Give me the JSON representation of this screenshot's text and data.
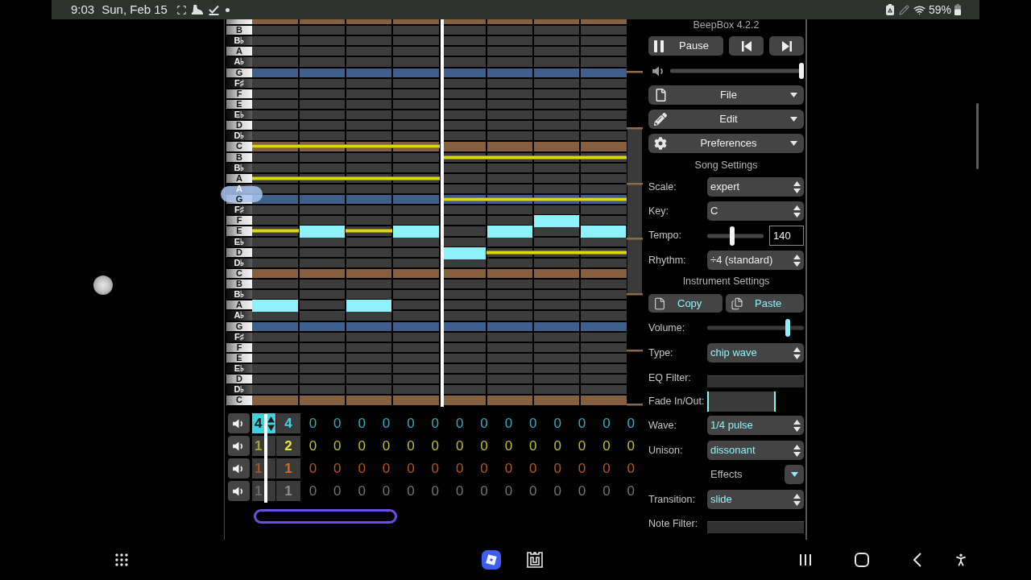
{
  "status_bar": {
    "time": "9:03",
    "date": "Sun, Feb 15",
    "battery": "59%"
  },
  "piano_roll": {
    "rows": [
      {
        "kind": "white",
        "color": "#86603e"
      },
      {
        "label": "B",
        "kind": "white",
        "color": "#3c3c3c"
      },
      {
        "label": "B♭",
        "kind": "black",
        "color": "#3c3c3c"
      },
      {
        "label": "A",
        "kind": "white",
        "color": "#3c3c3c"
      },
      {
        "label": "A♭",
        "kind": "black",
        "color": "#3c3c3c"
      },
      {
        "label": "G",
        "kind": "white",
        "color": "#3d5f8a"
      },
      {
        "label": "F♯",
        "kind": "black",
        "color": "#3c3c3c"
      },
      {
        "label": "F",
        "kind": "white",
        "color": "#3c3c3c"
      },
      {
        "label": "E",
        "kind": "white",
        "color": "#3c3c3c"
      },
      {
        "label": "E♭",
        "kind": "black",
        "color": "#3c3c3c"
      },
      {
        "label": "D",
        "kind": "white",
        "color": "#3c3c3c"
      },
      {
        "label": "D♭",
        "kind": "black",
        "color": "#3c3c3c"
      },
      {
        "label": "C",
        "kind": "white",
        "color": "#86603e",
        "beats": [
          {
            "kind": "ghost"
          },
          {
            "kind": "ghost"
          },
          {
            "kind": "ghost"
          },
          {
            "kind": "ghost"
          },
          {
            "kind": "none"
          },
          {
            "kind": "none"
          },
          {
            "kind": "none"
          },
          {
            "kind": "none"
          }
        ]
      },
      {
        "label": "B",
        "kind": "white",
        "color": "#3c3c3c",
        "beats": [
          {
            "kind": "none"
          },
          {
            "kind": "none"
          },
          {
            "kind": "none"
          },
          {
            "kind": "none"
          },
          {
            "kind": "ghost"
          },
          {
            "kind": "ghost"
          },
          {
            "kind": "ghost"
          },
          {
            "kind": "ghost"
          }
        ]
      },
      {
        "label": "B♭",
        "kind": "black",
        "color": "#3c3c3c"
      },
      {
        "label": "A",
        "kind": "white",
        "color": "#3c3c3c",
        "beats": [
          {
            "kind": "ghost"
          },
          {
            "kind": "ghost"
          },
          {
            "kind": "ghost"
          },
          {
            "kind": "ghost"
          },
          {
            "kind": "none"
          },
          {
            "kind": "none"
          },
          {
            "kind": "none"
          },
          {
            "kind": "none"
          }
        ]
      },
      {
        "label": "A",
        "kind": "black",
        "color": "#3c3c3c"
      },
      {
        "label": "G",
        "kind": "white",
        "color": "#3d5f8a",
        "beats": [
          {
            "kind": "none"
          },
          {
            "kind": "none"
          },
          {
            "kind": "none"
          },
          {
            "kind": "none"
          },
          {
            "kind": "ghost"
          },
          {
            "kind": "ghost"
          },
          {
            "kind": "ghost"
          },
          {
            "kind": "ghost"
          }
        ]
      },
      {
        "label": "F♯",
        "kind": "black",
        "color": "#3c3c3c"
      },
      {
        "label": "F",
        "kind": "white",
        "color": "#3c3c3c",
        "beats": [
          {
            "kind": "none"
          },
          {
            "kind": "none"
          },
          {
            "kind": "none"
          },
          {
            "kind": "none"
          },
          {
            "kind": "none"
          },
          {
            "kind": "none"
          },
          {
            "kind": "note"
          },
          {
            "kind": "none"
          }
        ]
      },
      {
        "label": "E",
        "kind": "white",
        "color": "#3c3c3c",
        "beats": [
          {
            "kind": "ghost"
          },
          {
            "kind": "note"
          },
          {
            "kind": "ghost"
          },
          {
            "kind": "note"
          },
          {
            "kind": "none"
          },
          {
            "kind": "note"
          },
          {
            "kind": "none"
          },
          {
            "kind": "note"
          }
        ]
      },
      {
        "label": "E♭",
        "kind": "black",
        "color": "#3c3c3c"
      },
      {
        "label": "D",
        "kind": "white",
        "color": "#3c3c3c",
        "beats": [
          {
            "kind": "none"
          },
          {
            "kind": "none"
          },
          {
            "kind": "none"
          },
          {
            "kind": "none"
          },
          {
            "kind": "note"
          },
          {
            "kind": "ghost"
          },
          {
            "kind": "ghost"
          },
          {
            "kind": "ghost"
          }
        ]
      },
      {
        "label": "D♭",
        "kind": "black",
        "color": "#3c3c3c"
      },
      {
        "label": "C",
        "kind": "white",
        "color": "#86603e"
      },
      {
        "label": "B",
        "kind": "white",
        "color": "#3c3c3c"
      },
      {
        "label": "B♭",
        "kind": "black",
        "color": "#3c3c3c"
      },
      {
        "label": "A",
        "kind": "white",
        "color": "#3c3c3c",
        "beats": [
          {
            "kind": "note"
          },
          {
            "kind": "none"
          },
          {
            "kind": "note"
          },
          {
            "kind": "none"
          },
          {
            "kind": "none"
          },
          {
            "kind": "none"
          },
          {
            "kind": "none"
          },
          {
            "kind": "none"
          }
        ]
      },
      {
        "label": "A♭",
        "kind": "black",
        "color": "#3c3c3c"
      },
      {
        "label": "G",
        "kind": "white",
        "color": "#3d5f8a"
      },
      {
        "label": "F♯",
        "kind": "black",
        "color": "#3c3c3c"
      },
      {
        "label": "F",
        "kind": "white",
        "color": "#3c3c3c"
      },
      {
        "label": "E",
        "kind": "white",
        "color": "#3c3c3c"
      },
      {
        "label": "E♭",
        "kind": "black",
        "color": "#3c3c3c"
      },
      {
        "label": "D",
        "kind": "white",
        "color": "#3c3c3c"
      },
      {
        "label": "D♭",
        "kind": "black",
        "color": "#3c3c3c"
      },
      {
        "label": "C",
        "kind": "white",
        "color": "#86603e"
      }
    ]
  },
  "tracks": {
    "channels": [
      {
        "color": "#3fd2dc",
        "cells": [
          {
            "label": "4",
            "kind": "faded",
            "selected": true
          },
          {
            "label": "4",
            "kind": "pattern",
            "selected": false
          },
          {
            "label": "0",
            "kind": "empty",
            "selected": false
          },
          {
            "label": "0",
            "kind": "empty",
            "selected": false
          },
          {
            "label": "0",
            "kind": "empty",
            "selected": false
          },
          {
            "label": "0",
            "kind": "empty",
            "selected": false
          },
          {
            "label": "0",
            "kind": "empty",
            "selected": false
          },
          {
            "label": "0",
            "kind": "empty",
            "selected": false
          },
          {
            "label": "0",
            "kind": "empty",
            "selected": false
          },
          {
            "label": "0",
            "kind": "empty",
            "selected": false
          },
          {
            "label": "0",
            "kind": "empty",
            "selected": false
          },
          {
            "label": "0",
            "kind": "empty",
            "selected": false
          },
          {
            "label": "0",
            "kind": "empty",
            "selected": false
          },
          {
            "label": "0",
            "kind": "empty",
            "selected": false
          },
          {
            "label": "0",
            "kind": "empty",
            "selected": false
          },
          {
            "label": "0",
            "kind": "empty",
            "selected": false
          }
        ]
      },
      {
        "color": "#e8e83e",
        "cells": [
          {
            "label": "1",
            "kind": "faded",
            "selected": false
          },
          {
            "label": "2",
            "kind": "pattern",
            "selected": false
          },
          {
            "label": "0",
            "kind": "empty",
            "selected": false
          },
          {
            "label": "0",
            "kind": "empty",
            "selected": false
          },
          {
            "label": "0",
            "kind": "empty",
            "selected": false
          },
          {
            "label": "0",
            "kind": "empty",
            "selected": false
          },
          {
            "label": "0",
            "kind": "empty",
            "selected": false
          },
          {
            "label": "0",
            "kind": "empty",
            "selected": false
          },
          {
            "label": "0",
            "kind": "empty",
            "selected": false
          },
          {
            "label": "0",
            "kind": "empty",
            "selected": false
          },
          {
            "label": "0",
            "kind": "empty",
            "selected": false
          },
          {
            "label": "0",
            "kind": "empty",
            "selected": false
          },
          {
            "label": "0",
            "kind": "empty",
            "selected": false
          },
          {
            "label": "0",
            "kind": "empty",
            "selected": false
          },
          {
            "label": "0",
            "kind": "empty",
            "selected": false
          },
          {
            "label": "0",
            "kind": "empty",
            "selected": false
          }
        ]
      },
      {
        "color": "#d66a22",
        "cells": [
          {
            "label": "1",
            "kind": "faded",
            "selected": false
          },
          {
            "label": "1",
            "kind": "pattern",
            "selected": false
          },
          {
            "label": "0",
            "kind": "empty",
            "selected": false
          },
          {
            "label": "0",
            "kind": "empty",
            "selected": false
          },
          {
            "label": "0",
            "kind": "empty",
            "selected": false
          },
          {
            "label": "0",
            "kind": "empty",
            "selected": false
          },
          {
            "label": "0",
            "kind": "empty",
            "selected": false
          },
          {
            "label": "0",
            "kind": "empty",
            "selected": false
          },
          {
            "label": "0",
            "kind": "empty",
            "selected": false
          },
          {
            "label": "0",
            "kind": "empty",
            "selected": false
          },
          {
            "label": "0",
            "kind": "empty",
            "selected": false
          },
          {
            "label": "0",
            "kind": "empty",
            "selected": false
          },
          {
            "label": "0",
            "kind": "empty",
            "selected": false
          },
          {
            "label": "0",
            "kind": "empty",
            "selected": false
          },
          {
            "label": "0",
            "kind": "empty",
            "selected": false
          },
          {
            "label": "0",
            "kind": "empty",
            "selected": false
          }
        ]
      },
      {
        "color": "#8c8c8c",
        "cells": [
          {
            "label": "1",
            "kind": "faded",
            "selected": false
          },
          {
            "label": "1",
            "kind": "pattern",
            "selected": false
          },
          {
            "label": "0",
            "kind": "empty",
            "selected": false
          },
          {
            "label": "0",
            "kind": "empty",
            "selected": false
          },
          {
            "label": "0",
            "kind": "empty",
            "selected": false
          },
          {
            "label": "0",
            "kind": "empty",
            "selected": false
          },
          {
            "label": "0",
            "kind": "empty",
            "selected": false
          },
          {
            "label": "0",
            "kind": "empty",
            "selected": false
          },
          {
            "label": "0",
            "kind": "empty",
            "selected": false
          },
          {
            "label": "0",
            "kind": "empty",
            "selected": false
          },
          {
            "label": "0",
            "kind": "empty",
            "selected": false
          },
          {
            "label": "0",
            "kind": "empty",
            "selected": false
          },
          {
            "label": "0",
            "kind": "empty",
            "selected": false
          },
          {
            "label": "0",
            "kind": "empty",
            "selected": false
          },
          {
            "label": "0",
            "kind": "empty",
            "selected": false
          },
          {
            "label": "0",
            "kind": "empty",
            "selected": false
          }
        ]
      }
    ]
  },
  "panel": {
    "version": "BeepBox 4.2.2",
    "transport": [
      {
        "kind": "pause",
        "label": "Pause"
      },
      {
        "kind": "previous"
      },
      {
        "kind": "next"
      }
    ],
    "volume": {
      "level": 1
    },
    "menus": [
      {
        "kind": "file",
        "label": "File"
      },
      {
        "kind": "edit",
        "label": "Edit"
      },
      {
        "kind": "preferences",
        "label": "Preferences"
      }
    ],
    "song_settings": {
      "title": "Song Settings",
      "rows": [
        {
          "kind": "select",
          "label": "Scale:",
          "value": "expert"
        },
        {
          "kind": "select",
          "label": "Key:",
          "value": "C"
        },
        {
          "kind": "tempo",
          "label": "Tempo:",
          "level": 0.43,
          "value": "140"
        },
        {
          "kind": "select",
          "label": "Rhythm:",
          "value": "÷4 (standard)"
        }
      ]
    },
    "instrument_settings": {
      "title": "Instrument Settings",
      "clipboard": [
        {
          "kind": "copy",
          "label": "Copy"
        },
        {
          "kind": "paste",
          "label": "Paste"
        }
      ],
      "rows": [
        {
          "kind": "slider",
          "label": "Volume:",
          "level": 0.85
        },
        {
          "kind": "select",
          "label": "Type:",
          "value": "chip wave"
        },
        {
          "kind": "filter",
          "label": "EQ Filter:"
        },
        {
          "kind": "fade",
          "label": "Fade In/Out:"
        },
        {
          "kind": "select",
          "label": "Wave:",
          "value": "1/4 pulse"
        },
        {
          "kind": "select",
          "label": "Unison:",
          "value": "dissonant"
        },
        {
          "kind": "section",
          "label": "Effects"
        },
        {
          "kind": "select",
          "label": "Transition:",
          "value": "slide"
        },
        {
          "kind": "filter",
          "label": "Note Filter:"
        }
      ]
    }
  }
}
